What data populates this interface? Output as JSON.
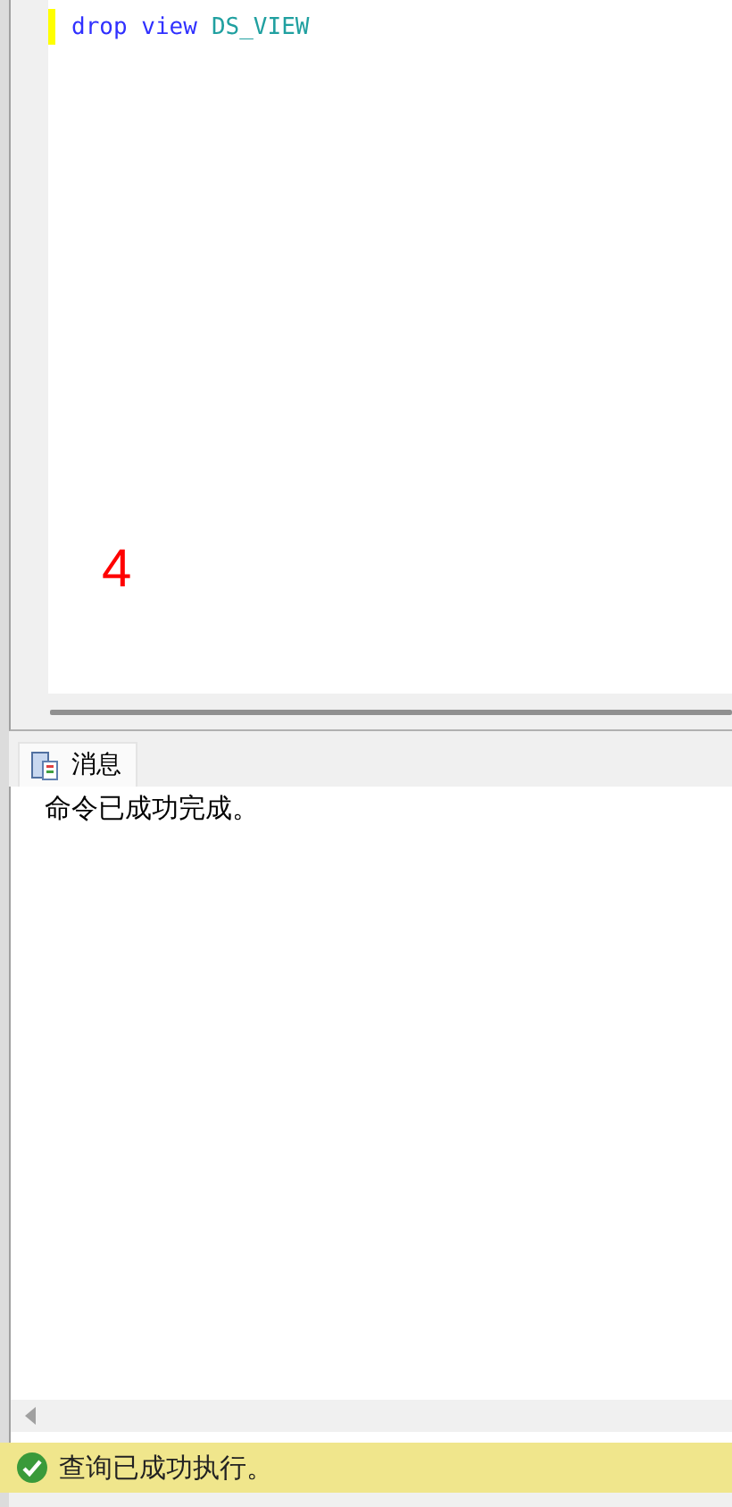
{
  "editor": {
    "lines": [
      {
        "tokens": [
          {
            "text": "drop view",
            "kind": "keyword"
          },
          {
            "text": "DS_VIEW",
            "kind": "identifier"
          }
        ],
        "changed": true
      }
    ]
  },
  "annotation": "4",
  "results": {
    "tabs": [
      {
        "label": "消息",
        "selected": true
      }
    ],
    "messages": [
      "命令已成功完成。"
    ]
  },
  "status_bar": {
    "text": "查询已成功执行。"
  }
}
